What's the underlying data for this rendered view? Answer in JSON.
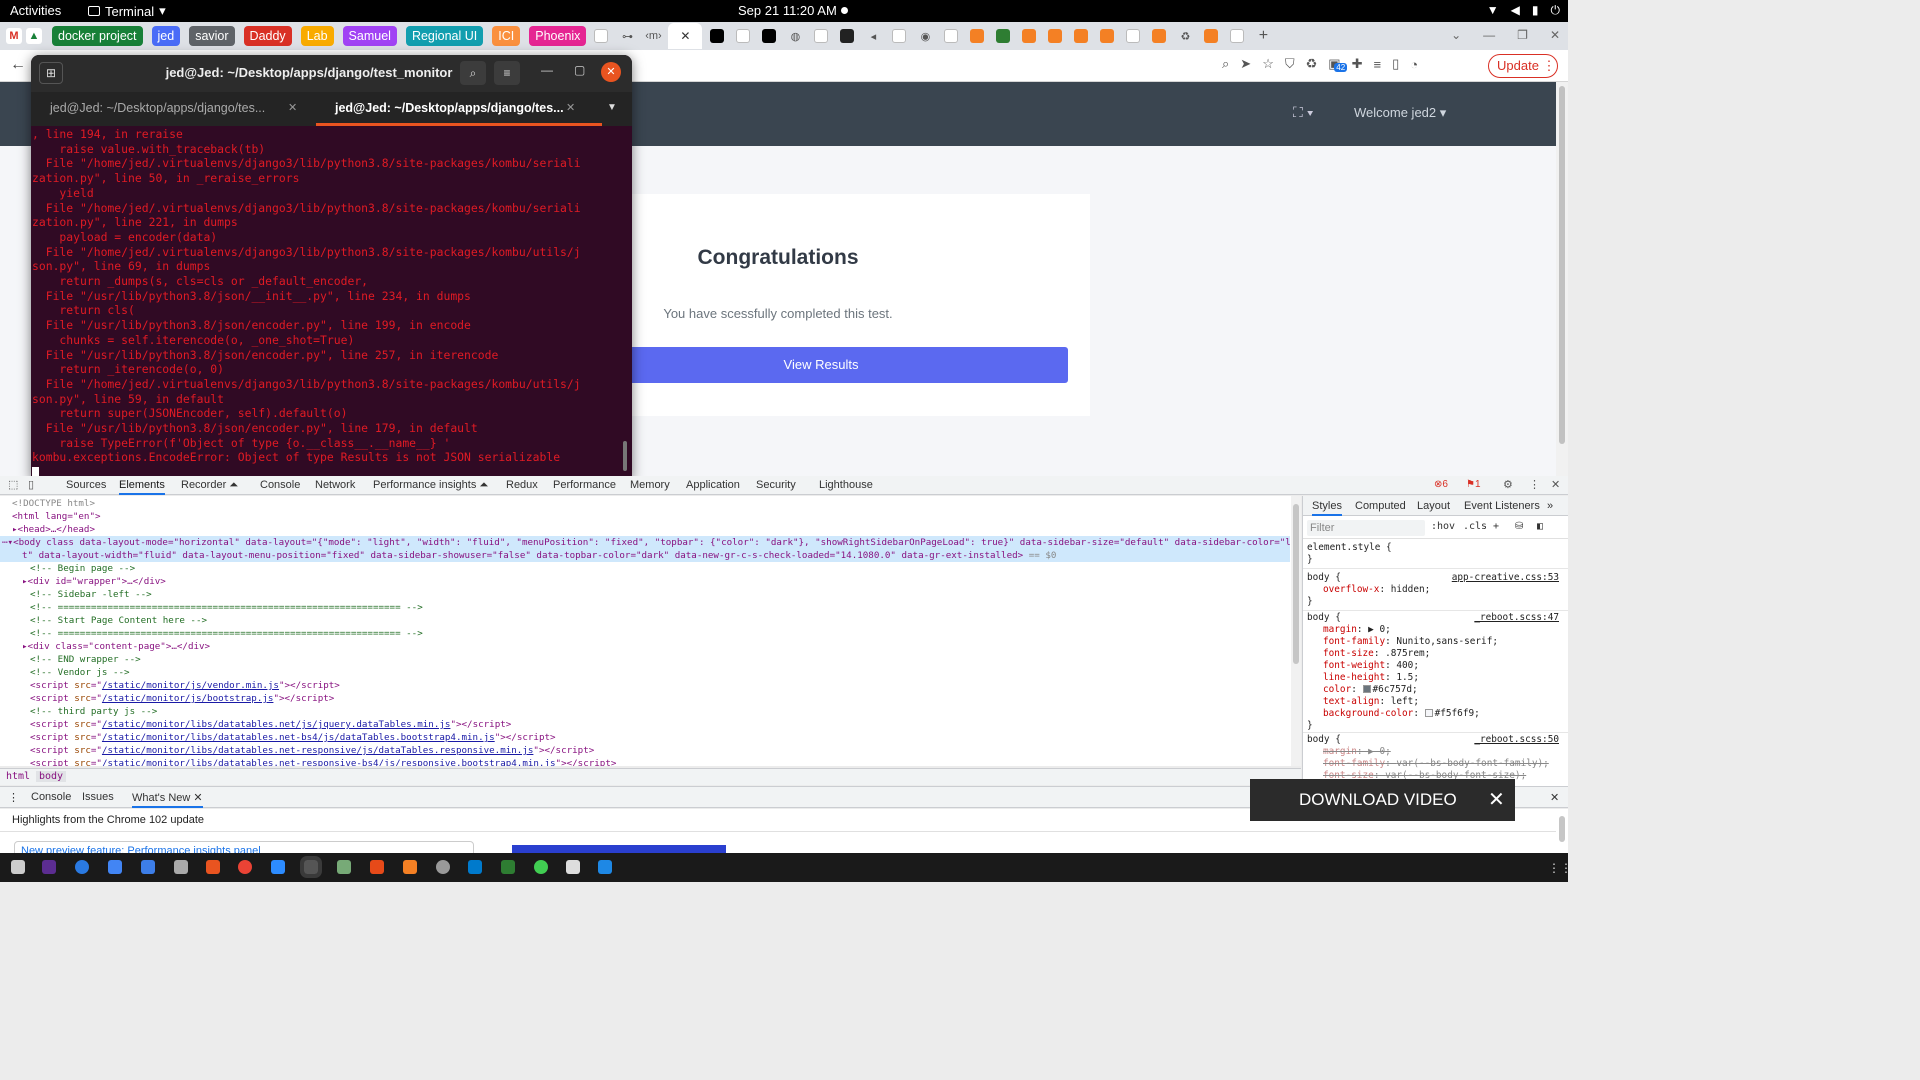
{
  "gnome": {
    "activities": "Activities",
    "app": "Terminal",
    "clock": "Sep 21  11:20 AM"
  },
  "browser": {
    "tab_groups": [
      {
        "label": "docker project",
        "color": "#188038"
      },
      {
        "label": "jed",
        "color": "#4a6cf7"
      },
      {
        "label": "savior",
        "color": "#5f6368"
      },
      {
        "label": "Daddy",
        "color": "#d93025"
      },
      {
        "label": "Lab",
        "color": "#f9ab00"
      },
      {
        "label": "Samuel",
        "color": "#a142f4"
      },
      {
        "label": "Regional UI",
        "color": "#129eaf"
      },
      {
        "label": "ICI",
        "color": "#fa903e"
      },
      {
        "label": "Phoenix",
        "color": "#e52592"
      }
    ],
    "update_label": "Update",
    "extension_badge": "42"
  },
  "page": {
    "welcome": "Welcome jed2",
    "card_title": "Congratulations",
    "card_text": "You have scessfully completed this test.",
    "card_button": "View Results"
  },
  "terminal": {
    "title": "jed@Jed: ~/Desktop/apps/django/test_monitor",
    "tabs": [
      "jed@Jed: ~/Desktop/apps/django/tes...",
      "jed@Jed: ~/Desktop/apps/django/tes..."
    ],
    "lines": [
      ", line 194, in reraise",
      "    raise value.with_traceback(tb)",
      "  File \"/home/jed/.virtualenvs/django3/lib/python3.8/site-packages/kombu/seriali",
      "zation.py\", line 50, in _reraise_errors",
      "    yield",
      "  File \"/home/jed/.virtualenvs/django3/lib/python3.8/site-packages/kombu/seriali",
      "zation.py\", line 221, in dumps",
      "    payload = encoder(data)",
      "  File \"/home/jed/.virtualenvs/django3/lib/python3.8/site-packages/kombu/utils/j",
      "son.py\", line 69, in dumps",
      "    return _dumps(s, cls=cls or _default_encoder,",
      "  File \"/usr/lib/python3.8/json/__init__.py\", line 234, in dumps",
      "    return cls(",
      "  File \"/usr/lib/python3.8/json/encoder.py\", line 199, in encode",
      "    chunks = self.iterencode(o, _one_shot=True)",
      "  File \"/usr/lib/python3.8/json/encoder.py\", line 257, in iterencode",
      "    return _iterencode(o, 0)",
      "  File \"/home/jed/.virtualenvs/django3/lib/python3.8/site-packages/kombu/utils/j",
      "son.py\", line 59, in default",
      "    return super(JSONEncoder, self).default(o)",
      "  File \"/usr/lib/python3.8/json/encoder.py\", line 179, in default",
      "    raise TypeError(f'Object of type {o.__class__.__name__} '",
      "kombu.exceptions.EncodeError: Object of type Results is not JSON serializable"
    ]
  },
  "devtools": {
    "tabs": [
      "Sources",
      "Elements",
      "Recorder ⏶",
      "Console",
      "Network",
      "Performance insights ⏶",
      "Redux",
      "Performance",
      "Memory",
      "Application",
      "Security",
      "Lighthouse"
    ],
    "errors": "6",
    "warnings": "1",
    "elements": {
      "doctype": "<!DOCTYPE html>",
      "html_open": "<html lang=\"en\">",
      "head": "<head>…</head>",
      "body_line1": "<body class data-layout-mode=\"horizontal\" data-layout=\"{\"mode\": \"light\", \"width\": \"fluid\", \"menuPosition\": \"fixed\", \"topbar\": {\"color\": \"dark\"}, \"showRightSidebarOnPageLoad\": true}\" data-sidebar-size=\"default\" data-sidebar-color=\"ligh",
      "body_line2": "t\" data-layout-width=\"fluid\" data-layout-menu-position=\"fixed\" data-sidebar-showuser=\"false\" data-topbar-color=\"dark\" data-new-gr-c-s-check-loaded=\"14.1080.0\" data-gr-ext-installed>",
      "body_eq": " == $0",
      "c_begin": "<!-- Begin page -->",
      "wrapper": "<div id=\"wrapper\">…</div>",
      "c_sidebar": "<!-- Sidebar -left -->",
      "c_eq1": "<!-- ============================================================== -->",
      "c_start": "<!-- Start Page Content here -->",
      "c_eq2": "<!-- ============================================================== -->",
      "content": "<div class=\"content-page\">…</div>",
      "c_end": "<!-- END wrapper -->",
      "c_vendor": "<!-- Vendor js -->",
      "s1": "/static/monitor/js/vendor.min.js",
      "s2": "/static/monitor/js/bootstrap.js",
      "c_third": "<!-- third party js -->",
      "s3": "/static/monitor/libs/datatables.net/js/jquery.dataTables.min.js",
      "s4": "/static/monitor/libs/datatables.net-bs4/js/dataTables.bootstrap4.min.js",
      "s5": "/static/monitor/libs/datatables.net-responsive/js/dataTables.responsive.min.js",
      "s6": "/static/monitor/libs/datatables.net-responsive-bs4/js/responsive.bootstrap4.min.js"
    },
    "crumbs": [
      "html",
      "body"
    ],
    "styles": {
      "tabs": [
        "Styles",
        "Computed",
        "Layout",
        "Event Listeners",
        "»"
      ],
      "filter_placeholder": "Filter",
      "hov": ":hov",
      "cls": ".cls",
      "element_style": "element.style {",
      "rule1_src": "app-creative.css:53",
      "rule1_prop": "overflow-x",
      "rule1_val": "hidden;",
      "rule2_src": "_reboot.scss:47",
      "rule2": [
        {
          "p": "margin",
          "v": "▶ 0;"
        },
        {
          "p": "font-family",
          "v": "Nunito,sans-serif;"
        },
        {
          "p": "font-size",
          "v": ".875rem;"
        },
        {
          "p": "font-weight",
          "v": "400;"
        },
        {
          "p": "line-height",
          "v": "1.5;"
        },
        {
          "p": "color",
          "v": "#6c757d;",
          "swatch": "#6c757d"
        },
        {
          "p": "text-align",
          "v": "left;"
        },
        {
          "p": "background-color",
          "v": "#f5f6f9;",
          "swatch": "#f5f6f9"
        }
      ],
      "rule3_src": "_reboot.scss:50",
      "rule3": [
        {
          "p": "margin",
          "v": "▶ 0;"
        },
        {
          "p": "font-family",
          "v": "var(--bs-body-font-family);"
        },
        {
          "p": "font-size",
          "v": "var(--bs-body-font-size);"
        }
      ]
    },
    "drawer_tabs": [
      "Console",
      "Issues",
      "What's New"
    ],
    "highlights": "Highlights from the Chrome 102 update",
    "new_feature": "New preview feature: Performance insights panel"
  },
  "overlay": {
    "download_video": "DOWNLOAD VIDEO"
  }
}
